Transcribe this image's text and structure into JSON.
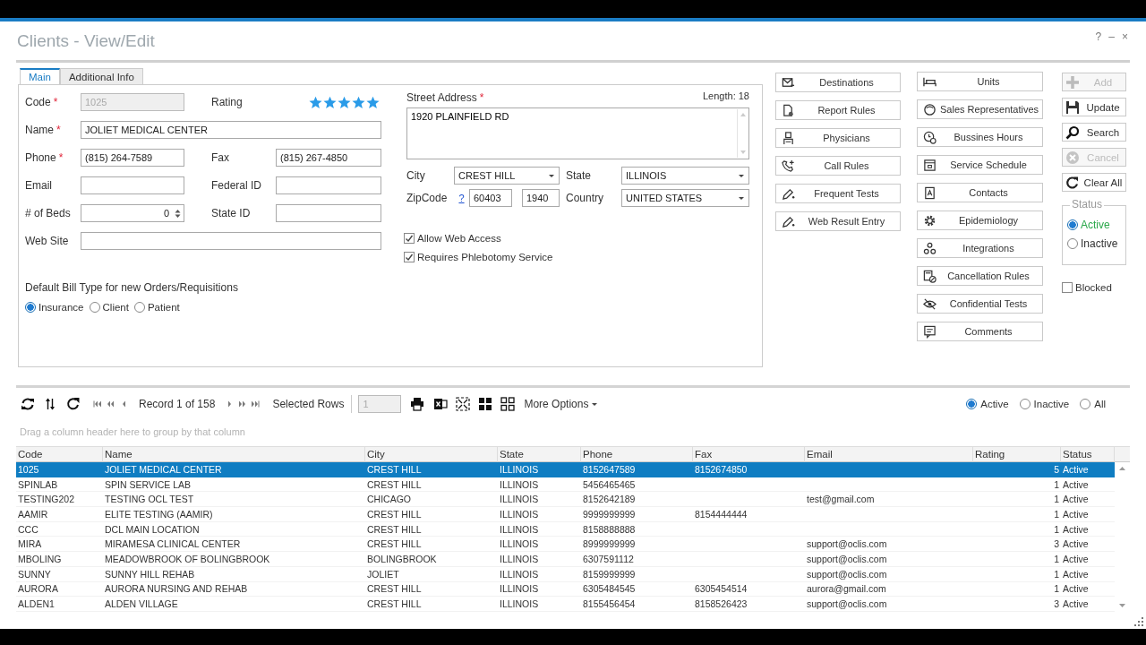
{
  "window": {
    "title": "Clients - View/Edit",
    "controls": [
      "?",
      "–",
      "×"
    ]
  },
  "tabs": [
    {
      "label": "Main",
      "selected": true
    },
    {
      "label": "Additional Info",
      "selected": false
    }
  ],
  "form": {
    "code": {
      "label": "Code",
      "mark": "*",
      "value": "1025",
      "disabled": true
    },
    "rating": {
      "label": "Rating",
      "stars": 5
    },
    "name": {
      "label": "Name",
      "mark": "*",
      "value": "JOLIET MEDICAL CENTER"
    },
    "phone": {
      "label": "Phone",
      "mark": "*",
      "value": "(815) 264-7589"
    },
    "fax": {
      "label": "Fax",
      "value": "(815) 267-4850"
    },
    "email": {
      "label": "Email"
    },
    "federal_id": {
      "label": "Federal ID"
    },
    "beds": {
      "label": "# of Beds",
      "value": "0"
    },
    "state_id": {
      "label": "State ID"
    },
    "web_site": {
      "label": "Web Site"
    },
    "bill_type": {
      "label": "Default Bill Type for new Orders/Requisitions",
      "options": [
        {
          "label": "Insurance",
          "selected": true
        },
        {
          "label": "Client",
          "selected": false
        },
        {
          "label": "Patient",
          "selected": false
        }
      ]
    },
    "street_address": {
      "label": "Street Address",
      "mark": "*",
      "length": "Length: 18",
      "value": "1920 PLAINFIELD RD"
    },
    "city": {
      "label": "City",
      "value": "CREST HILL"
    },
    "state": {
      "label": "State",
      "value": "ILLINOIS"
    },
    "zipcode": {
      "label": "ZipCode",
      "help": "?",
      "value": "60403",
      "extension": "1940"
    },
    "country": {
      "label": "Country",
      "value": "UNITED STATES"
    },
    "checkboxes": [
      {
        "label": "Allow Web Access",
        "checked": true
      },
      {
        "label": "Requires Phlebotomy Service",
        "checked": true
      }
    ]
  },
  "detail_buttons_left": [
    "Destinations",
    "Report Rules",
    "Physicians",
    "Call Rules",
    "Frequent Tests",
    "Web Result Entry"
  ],
  "detail_buttons_right": [
    "Units",
    "Sales Representatives",
    "Bussines Hours",
    "Service Schedule",
    "Contacts",
    "Epidemiology",
    "Integrations",
    "Cancellation Rules",
    "Confidential Tests",
    "Comments"
  ],
  "actions": [
    {
      "label": "Add",
      "disabled": true
    },
    {
      "label": "Update",
      "disabled": false
    },
    {
      "label": "Search",
      "disabled": false
    },
    {
      "label": "Cancel",
      "disabled": true
    },
    {
      "label": "Clear All",
      "disabled": false
    }
  ],
  "status": {
    "title": "Status",
    "options": [
      {
        "label": "Active",
        "selected": true
      },
      {
        "label": "Inactive",
        "selected": false
      }
    ],
    "blocked": {
      "label": "Blocked",
      "checked": false
    }
  },
  "grid": {
    "toolbar": {
      "record": "Record 1 of 158",
      "selected_rows_label": "Selected Rows",
      "selected_rows": "1",
      "selected_rows_disabled": true,
      "more_options": "More Options",
      "filters": [
        {
          "label": "Active",
          "selected": true
        },
        {
          "label": "Inactive",
          "selected": false
        },
        {
          "label": "All",
          "selected": false
        }
      ]
    },
    "group_hint": "Drag a column header here to group by that column",
    "columns": [
      "Code",
      "Name",
      "City",
      "State",
      "Phone",
      "Fax",
      "Email",
      "Rating",
      "Status"
    ],
    "rows": [
      {
        "selected": true,
        "code": "1025",
        "name": "JOLIET MEDICAL CENTER",
        "city": "CREST HILL",
        "state": "ILLINOIS",
        "phone": "8152647589",
        "fax": "8152674850",
        "rating": "5",
        "status": "Active"
      },
      {
        "selected": false,
        "code": "SPINLAB",
        "name": "SPIN SERVICE LAB",
        "city": "CREST HILL",
        "state": "ILLINOIS",
        "phone": "5456465465",
        "rating": "1",
        "status": "Active"
      },
      {
        "selected": false,
        "code": "TESTING202",
        "name": "TESTING OCL TEST",
        "city": "CHICAGO",
        "state": "ILLINOIS",
        "phone": "8152642189",
        "email": "test@gmail.com",
        "rating": "1",
        "status": "Active"
      },
      {
        "selected": false,
        "code": "AAMIR",
        "name": "ELITE TESTING (AAMIR)",
        "city": "CREST HILL",
        "state": "ILLINOIS",
        "phone": "9999999999",
        "fax": "8154444444",
        "rating": "1",
        "status": "Active"
      },
      {
        "selected": false,
        "code": "CCC",
        "name": "DCL MAIN LOCATION",
        "city": "CREST HILL",
        "state": "ILLINOIS",
        "phone": "8158888888",
        "rating": "1",
        "status": "Active"
      },
      {
        "selected": false,
        "code": "MIRA",
        "name": "MIRAMESA CLINICAL CENTER",
        "city": "CREST HILL",
        "state": "ILLINOIS",
        "phone": "8999999999",
        "email": "support@oclis.com",
        "rating": "3",
        "status": "Active"
      },
      {
        "selected": false,
        "code": "MBOLING",
        "name": "MEADOWBROOK OF BOLINGBROOK",
        "city": "BOLINGBROOK",
        "state": "ILLINOIS",
        "phone": "6307591112",
        "email": "support@oclis.com",
        "rating": "1",
        "status": "Active"
      },
      {
        "selected": false,
        "code": "SUNNY",
        "name": "SUNNY HILL REHAB",
        "city": "JOLIET",
        "state": "ILLINOIS",
        "phone": "8159999999",
        "email": "support@oclis.com",
        "rating": "1",
        "status": "Active"
      },
      {
        "selected": false,
        "code": "AURORA",
        "name": "AURORA NURSING AND REHAB",
        "city": "CREST HILL",
        "state": "ILLINOIS",
        "phone": "6305484545",
        "fax": "6305454514",
        "email": "aurora@gmail.com",
        "rating": "1",
        "status": "Active"
      },
      {
        "selected": false,
        "code": "ALDEN1",
        "name": "ALDEN VILLAGE",
        "city": "CREST HILL",
        "state": "ILLINOIS",
        "phone": "8155456454",
        "fax": "8158526423",
        "email": "support@oclis.com",
        "rating": "3",
        "status": "Active"
      }
    ]
  }
}
